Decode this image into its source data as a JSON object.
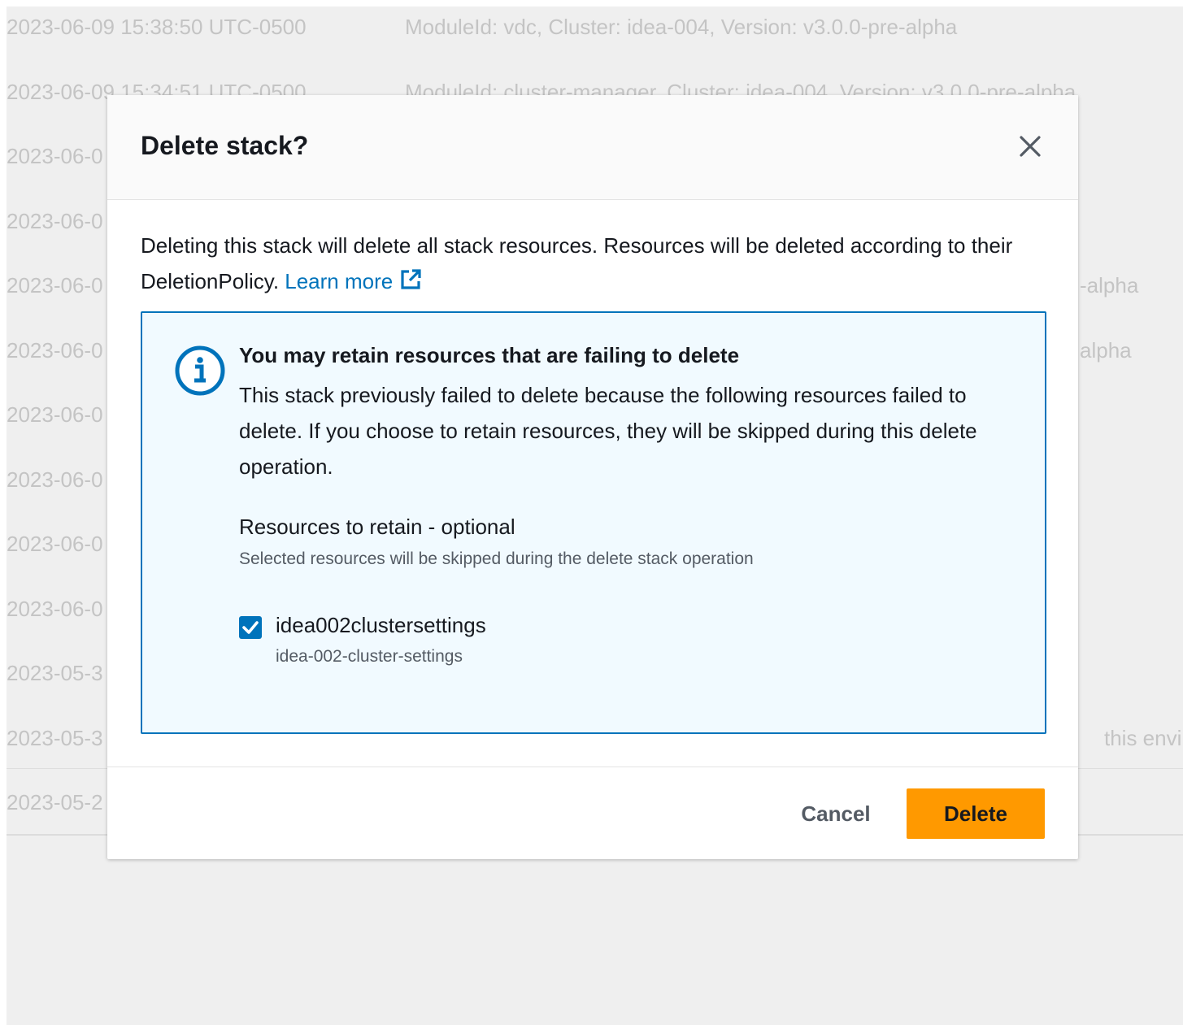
{
  "background": {
    "rows": [
      {
        "timestamp": "2023-06-09 15:38:50 UTC-0500",
        "description": "ModuleId: vdc, Cluster: idea-004, Version: v3.0.0-pre-alpha"
      },
      {
        "timestamp": "2023-06-09 15:34:51 UTC-0500",
        "description": "ModuleId: cluster-manager, Cluster: idea-004, Version: v3.0.0-pre-alpha"
      },
      {
        "timestamp": "2023-06-0",
        "description": ""
      },
      {
        "timestamp": "2023-06-0",
        "description": ""
      },
      {
        "timestamp": "2023-06-0",
        "description": "-alpha"
      },
      {
        "timestamp": "2023-06-0",
        "description": "alpha"
      },
      {
        "timestamp": "2023-06-0",
        "description": ""
      },
      {
        "timestamp": "2023-06-0",
        "description": ""
      },
      {
        "timestamp": "2023-06-0",
        "description": ""
      },
      {
        "timestamp": "2023-06-0",
        "description": ""
      },
      {
        "timestamp": "2023-05-3",
        "description": ""
      },
      {
        "timestamp": "2023-05-3",
        "description": "this envi"
      },
      {
        "timestamp": "2023-05-2",
        "description": ""
      }
    ]
  },
  "modal": {
    "title": "Delete stack?",
    "close_icon": "close-icon",
    "intro_text": "Deleting this stack will delete all stack resources. Resources will be deleted according to their DeletionPolicy. ",
    "learn_more": "Learn more",
    "info": {
      "icon": "info-icon",
      "title": "You may retain resources that are failing to delete",
      "body": "This stack previously failed to delete because the following resources failed to delete. If you choose to retain resources, they will be skipped during this delete operation.",
      "retain_label": "Resources to retain - optional",
      "retain_description": "Selected resources will be skipped during the delete stack operation",
      "resources": [
        {
          "name": "idea002clustersettings",
          "physical_id": "idea-002-cluster-settings",
          "checked": true
        }
      ]
    },
    "footer": {
      "cancel_label": "Cancel",
      "delete_label": "Delete"
    }
  },
  "colors": {
    "accent_blue": "#0073bb",
    "primary_orange": "#ff9900",
    "info_bg": "#f1faff",
    "overlay_bg": "#efefef"
  }
}
